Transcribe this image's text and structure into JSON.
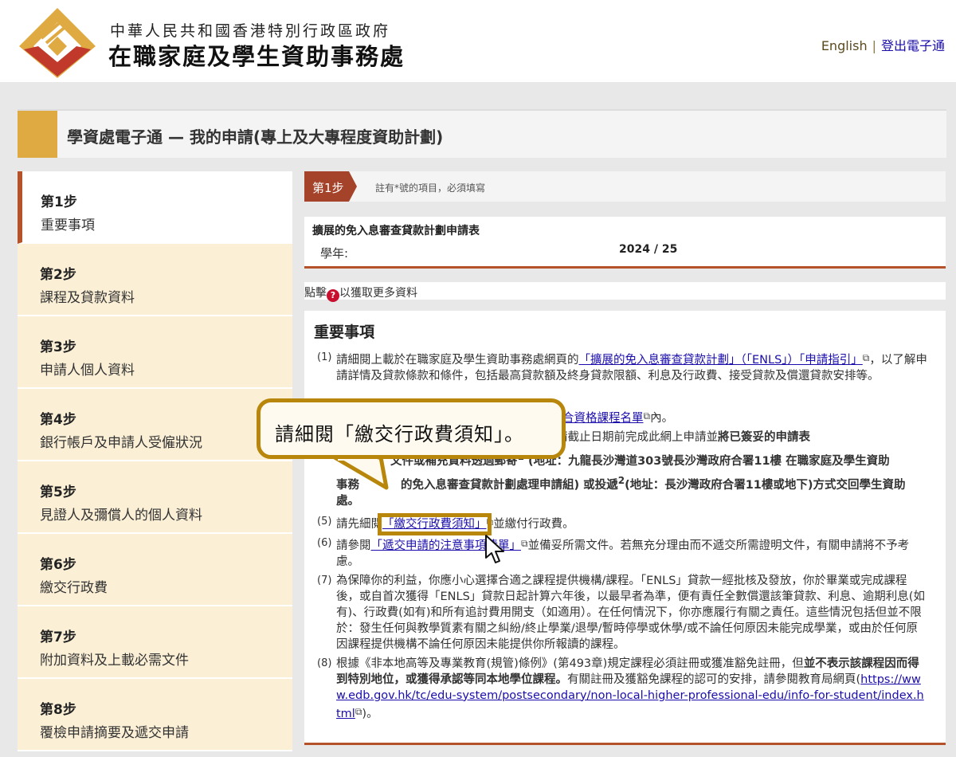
{
  "header": {
    "org_line1": "中華人民共和國香港特別行政區政府",
    "org_line2": "在職家庭及學生資助事務處",
    "lang_link": "English",
    "separator": "|",
    "logout_link": "登出電子通"
  },
  "page_title": "學資處電子通 — 我的申請(專上及大專程度資助計劃)",
  "sidebar": {
    "steps": [
      {
        "num": "第1步",
        "name": "重要事項",
        "active": true
      },
      {
        "num": "第2步",
        "name": "課程及貸款資料"
      },
      {
        "num": "第3步",
        "name": "申請人個人資料"
      },
      {
        "num": "第4步",
        "name": "銀行帳戶及申請人受僱狀況"
      },
      {
        "num": "第5步",
        "name": "見證人及彌償人的個人資料"
      },
      {
        "num": "第6步",
        "name": "繳交行政費"
      },
      {
        "num": "第7步",
        "name": "附加資料及上載必需文件"
      },
      {
        "num": "第8步",
        "name": "覆檢申請摘要及遞交申請"
      }
    ]
  },
  "stepbar": {
    "badge": "第1步",
    "note": "註有*號的項目，必須填寫"
  },
  "form": {
    "title": "擴展的免入息審查貸款計劃申請表",
    "year_label": "學年:",
    "year_value": "2024 / 25"
  },
  "info": {
    "prefix": "點擊",
    "icon": "question-icon",
    "suffix": "以獲取更多資料"
  },
  "content": {
    "heading": "重要事項",
    "item1": {
      "no": "(1)",
      "t1": "請細閱上載於在職家庭及學生資助事務處網頁的",
      "link": "「擴展的免入息審查貸款計劃」（「ENLS」）「申請指引」",
      "t2": "，以了解申請詳情及貸款條款和條件，包括最高貸款額及終身貸款限額、利息及行政費、接受貸款及償還貸款安排等。"
    },
    "item3": {
      "link": "合資格課程名單",
      "t": "內。"
    },
    "item4": {
      "t1": "請注意，你需於申請截止日期前完成此網上申請並",
      "b1": "將已簽妥的申請表",
      "b2": "文件或補充資料透過郵寄",
      "sup1": "1",
      "b3": "(地址：九龍長沙灣道303號長沙灣政府合署11樓 在職家庭及學生資助",
      "b4": "事務",
      "b5": "的免入息審查貸款計劃處理申請組) 或投遞",
      "sup2": "2",
      "b6": "(地址：長沙灣政府合署11樓或地下)方式交回學生資助處。"
    },
    "item5": {
      "no": "(5)",
      "t1": "請先細閱",
      "link": "「繳交行政費須知」",
      "t2": "並繳付行政費。"
    },
    "item6": {
      "no": "(6)",
      "t1": "請參閱",
      "link": "「遞交申請的注意事項清單」",
      "t2": "並備妥所需文件。若無充分理由而不遞交所需證明文件，有關申請將不予考慮。"
    },
    "item7": {
      "no": "(7)",
      "t": "為保障你的利益，你應小心選擇合適之課程提供機構/課程。「ENLS」貸款一經批核及發放，你於畢業或完成課程後，或自首次獲得「ENLS」貸款日起計算六年後，以最早者為準，便有責任全數償還該筆貸款、利息、逾期利息(如有)、行政費(如有)和所有追討費用開支（如適用）。在任何情況下，你亦應履行有關之責任。這些情況包括但並不限於：發生任何與教學質素有關之糾紛/終止學業/退學/暫時停學或休學/或不論任何原因未能完成學業，或由於任何原因課程提供機構不論任何原因未能提供你所報讀的課程。"
    },
    "item8": {
      "no": "(8)",
      "t1": "根據《非本地高等及專業教育(規管)條例》(第493章)規定課程必須註冊或獲准豁免註冊，但",
      "b": "並不表示該課程因而得到特別地位，或獲得承認等同本地學位課程。",
      "t2": "有關註冊及獲豁免課程的認可的安排，請參閱教育局網頁(",
      "url": "https://www.edb.gov.hk/tc/edu-system/postsecondary/non-local-higher-professional-edu/info-for-student/index.html",
      "t3": ")。"
    }
  },
  "callout": {
    "text": "請細閱「繳交行政費須知」。"
  },
  "colors": {
    "accent_gold": "#e0aa42",
    "step_red": "#a5432a",
    "callout_border": "#b8860b",
    "sidebar_bg": "#fbefd6"
  }
}
